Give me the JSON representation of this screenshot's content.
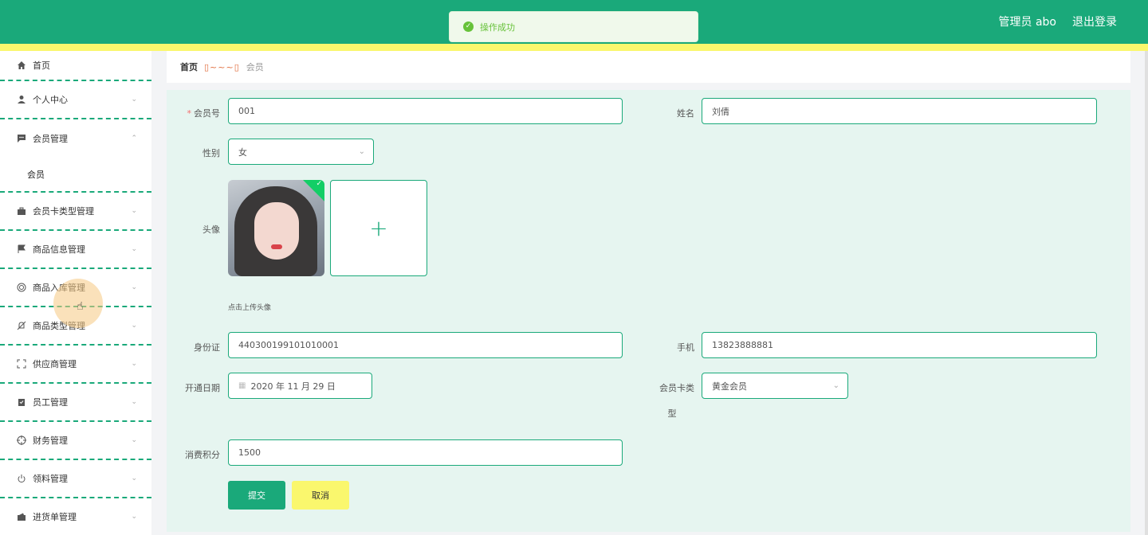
{
  "header": {
    "user_label": "管理员 abo",
    "logout_label": "退出登录"
  },
  "toast": {
    "message": "操作成功"
  },
  "sidebar": {
    "items": [
      {
        "label": "首页",
        "icon": "home-icon"
      },
      {
        "label": "个人中心",
        "icon": "user-icon"
      },
      {
        "label": "会员管理",
        "icon": "chat-icon"
      },
      {
        "label": "会员卡类型管理",
        "icon": "briefcase-icon"
      },
      {
        "label": "商品信息管理",
        "icon": "flag-icon"
      },
      {
        "label": "商品入库管理",
        "icon": "lifebuoy-icon"
      },
      {
        "label": "商品类型管理",
        "icon": "bell-off-icon"
      },
      {
        "label": "供应商管理",
        "icon": "fullscreen-icon"
      },
      {
        "label": "员工管理",
        "icon": "clipboard-icon"
      },
      {
        "label": "财务管理",
        "icon": "crosshair-icon"
      },
      {
        "label": "领料管理",
        "icon": "power-icon"
      },
      {
        "label": "进货单管理",
        "icon": "wallet-icon"
      }
    ],
    "subitem": "会员"
  },
  "breadcrumb": {
    "home": "首页",
    "current": "会员"
  },
  "form": {
    "member_no_label": "会员号",
    "member_no_value": "001",
    "name_label": "姓名",
    "name_value": "刘倩",
    "gender_label": "性别",
    "gender_value": "女",
    "avatar_label": "头像",
    "avatar_hint": "点击上传头像",
    "id_label": "身份证",
    "id_value": "440300199101010001",
    "phone_label": "手机",
    "phone_value": "13823888881",
    "open_date_label": "开通日期",
    "open_date_value": "2020 年 11 月 29 日",
    "card_type_label_1": "会员卡类",
    "card_type_label_2": "型",
    "card_type_value": "黄金会员",
    "points_label": "消费积分",
    "points_value": "1500",
    "submit_label": "提交",
    "cancel_label": "取消"
  }
}
